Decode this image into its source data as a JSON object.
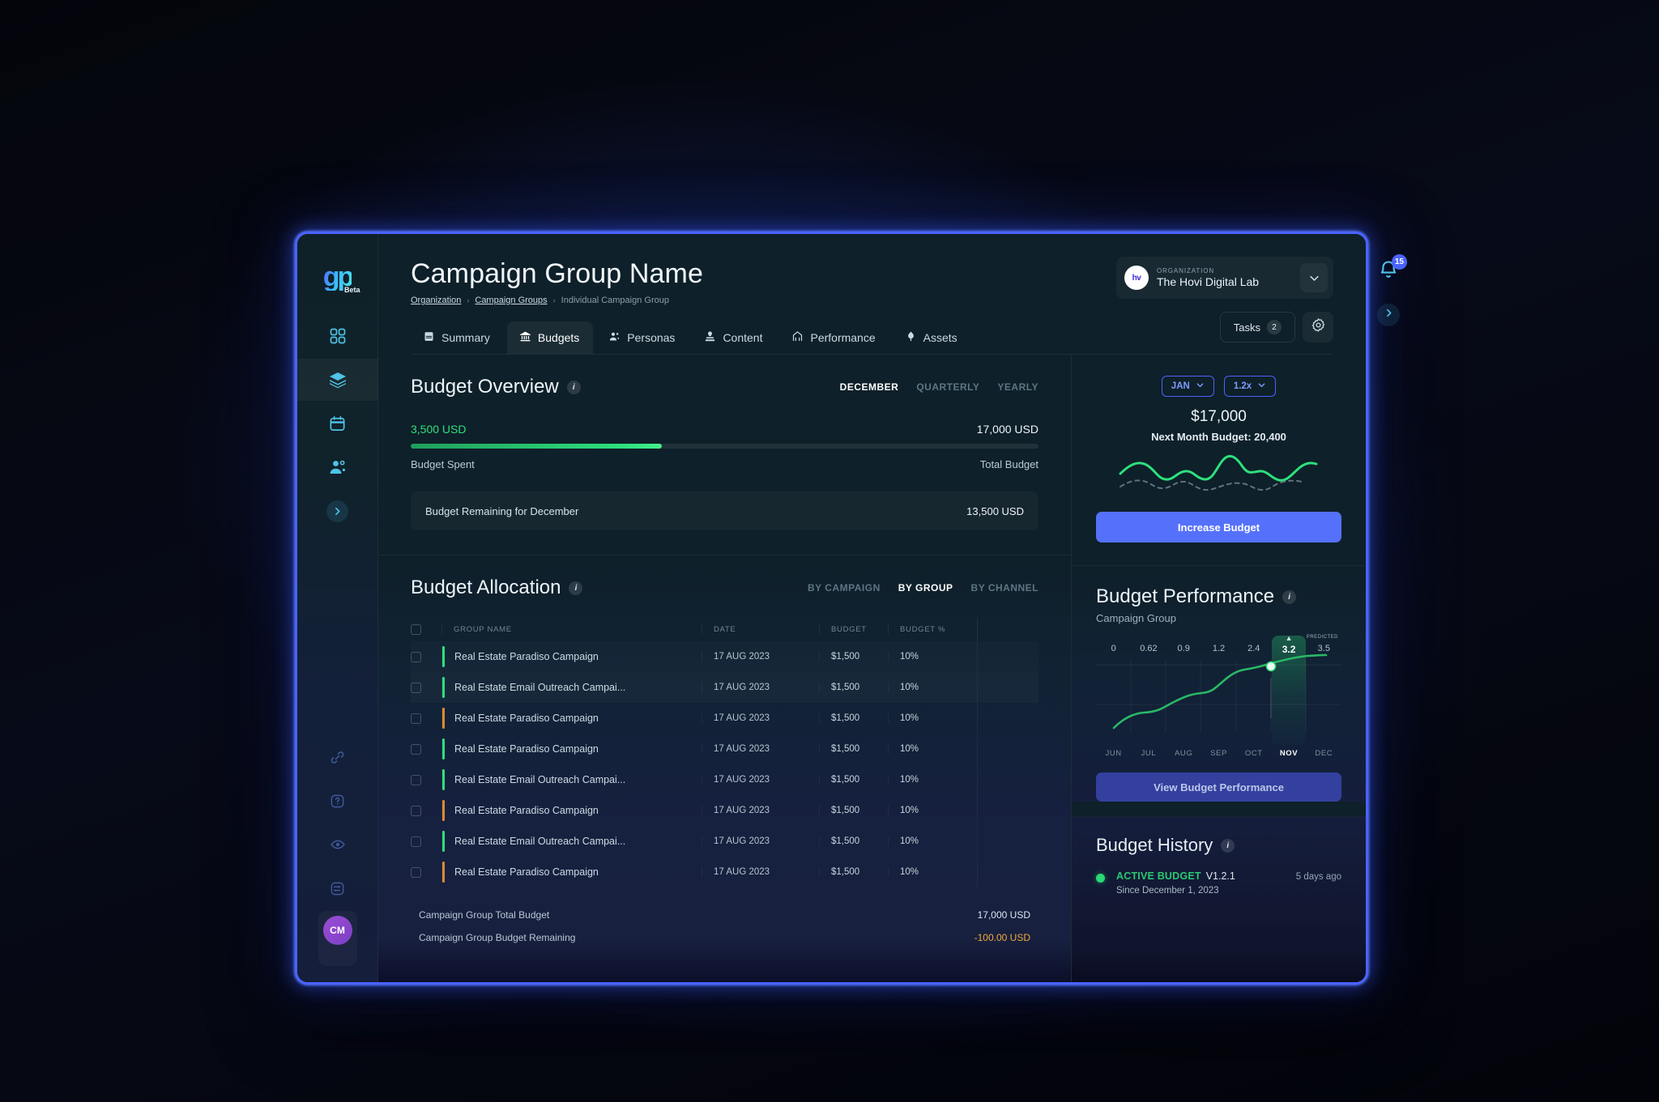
{
  "sidebar": {
    "logo": {
      "glyph": "gp",
      "badge": "Beta"
    },
    "items": [
      {
        "name": "dashboard-icon",
        "label": "Dashboard"
      },
      {
        "name": "layers-icon",
        "label": "Campaign Groups"
      },
      {
        "name": "calendar-icon",
        "label": "Calendar"
      },
      {
        "name": "people-icon",
        "label": "Audiences"
      },
      {
        "name": "chevron-right-icon",
        "label": "Expand"
      }
    ],
    "bottom_items": [
      {
        "name": "link-icon",
        "label": "Integrations"
      },
      {
        "name": "help-icon",
        "label": "Help"
      },
      {
        "name": "eye-icon",
        "label": "Preview"
      },
      {
        "name": "sliders-icon",
        "label": "Settings"
      }
    ],
    "avatar_initials": "CM"
  },
  "header": {
    "title": "Campaign Group Name",
    "breadcrumb": {
      "organization": "Organization",
      "campaign_groups": "Campaign Groups",
      "current": "Individual Campaign Group",
      "separator": "›"
    },
    "organization": {
      "label": "ORGANIZATION",
      "name": "The Hovi Digital Lab",
      "avatar_text": "hv"
    },
    "tasks": {
      "label": "Tasks",
      "count": "2"
    }
  },
  "tabs": [
    {
      "label": "Summary",
      "icon": "book-icon",
      "active": false
    },
    {
      "label": "Budgets",
      "icon": "bank-icon",
      "active": true
    },
    {
      "label": "Personas",
      "icon": "people-icon",
      "active": false
    },
    {
      "label": "Content",
      "icon": "pen-icon",
      "active": false
    },
    {
      "label": "Performance",
      "icon": "chart-icon",
      "active": false
    },
    {
      "label": "Assets",
      "icon": "diamond-icon",
      "active": false
    }
  ],
  "overview": {
    "title": "Budget Overview",
    "segments": [
      {
        "label": "DECEMBER",
        "active": true
      },
      {
        "label": "QUARTERLY",
        "active": false
      },
      {
        "label": "YEARLY",
        "active": false
      }
    ],
    "spent_amount": "3,500 USD",
    "total_amount": "17,000 USD",
    "spent_label": "Budget Spent",
    "total_label": "Total Budget",
    "progress_percent": 40,
    "remaining_label": "Budget Remaining for December",
    "remaining_value": "13,500 USD"
  },
  "budget_control": {
    "month_pill": "JAN",
    "multiplier_pill": "1.2x",
    "amount": "$17,000",
    "next_month": "Next Month Budget: 20,400",
    "increase_label": "Increase Budget"
  },
  "allocation": {
    "title": "Budget Allocation",
    "segments": [
      {
        "label": "BY CAMPAIGN",
        "active": false
      },
      {
        "label": "BY GROUP",
        "active": true
      },
      {
        "label": "BY CHANNEL",
        "active": false
      }
    ],
    "columns": [
      "GROUP NAME",
      "DATE",
      "BUDGET",
      "BUDGET %"
    ],
    "rows": [
      {
        "name": "Real Estate Paradiso Campaign",
        "date": "17 AUG 2023",
        "budget": "$1,500",
        "pct": "10%",
        "accent": "#2ee07d"
      },
      {
        "name": "Real Estate Email Outreach Campai...",
        "date": "17 AUG 2023",
        "budget": "$1,500",
        "pct": "10%",
        "accent": "#2ee07d"
      },
      {
        "name": "Real Estate Paradiso Campaign",
        "date": "17 AUG 2023",
        "budget": "$1,500",
        "pct": "10%",
        "accent": "#e08a2e"
      },
      {
        "name": "Real Estate Paradiso Campaign",
        "date": "17 AUG 2023",
        "budget": "$1,500",
        "pct": "10%",
        "accent": "#2ee07d"
      },
      {
        "name": "Real Estate Email Outreach Campai...",
        "date": "17 AUG 2023",
        "budget": "$1,500",
        "pct": "10%",
        "accent": "#2ee07d"
      },
      {
        "name": "Real Estate Paradiso Campaign",
        "date": "17 AUG 2023",
        "budget": "$1,500",
        "pct": "10%",
        "accent": "#e08a2e"
      },
      {
        "name": "Real Estate Email Outreach Campai...",
        "date": "17 AUG 2023",
        "budget": "$1,500",
        "pct": "10%",
        "accent": "#2ee07d"
      },
      {
        "name": "Real Estate Paradiso Campaign",
        "date": "17 AUG 2023",
        "budget": "$1,500",
        "pct": "10%",
        "accent": "#e08a2e"
      }
    ],
    "totals": [
      {
        "label": "Campaign Group Total Budget",
        "value": "17,000 USD",
        "negative": false
      },
      {
        "label": "Campaign Group Budget Remaining",
        "value": "-100.00 USD",
        "negative": true
      }
    ]
  },
  "performance": {
    "title": "Budget Performance",
    "subtitle": "Campaign Group",
    "predicted_tag": "PREDICTED",
    "view_button": "View Budget Performance"
  },
  "history": {
    "title": "Budget History",
    "status": "ACTIVE BUDGET",
    "version": "V1.2.1",
    "ago": "5 days ago",
    "since": "Since December 1, 2023"
  },
  "floating": {
    "notification_count": "15"
  },
  "colors": {
    "accent_blue": "#4a63ff",
    "accent_green": "#2ee07d",
    "accent_orange": "#e08a2e",
    "panel_dark": "#0e2029"
  },
  "chart_data": {
    "type": "line",
    "title": "Budget Performance",
    "subtitle": "Campaign Group",
    "categories": [
      "JUN",
      "JUL",
      "AUG",
      "SEP",
      "OCT",
      "NOV",
      "DEC"
    ],
    "values": [
      0,
      0.62,
      0.9,
      1.2,
      2.4,
      3.2,
      3.5
    ],
    "value_labels": [
      "0",
      "0.62",
      "0.9",
      "1.2",
      "2.4",
      "3.2",
      "3.5"
    ],
    "highlight_index": 5,
    "highlight_label": "NOV",
    "highlight_value": "3.2",
    "predicted_index": 6,
    "predicted_label": "PREDICTED",
    "xlabel": "",
    "ylabel": "",
    "ylim": [
      0,
      4
    ],
    "grid": true,
    "legend": "none",
    "line_color": "#2ab866"
  }
}
